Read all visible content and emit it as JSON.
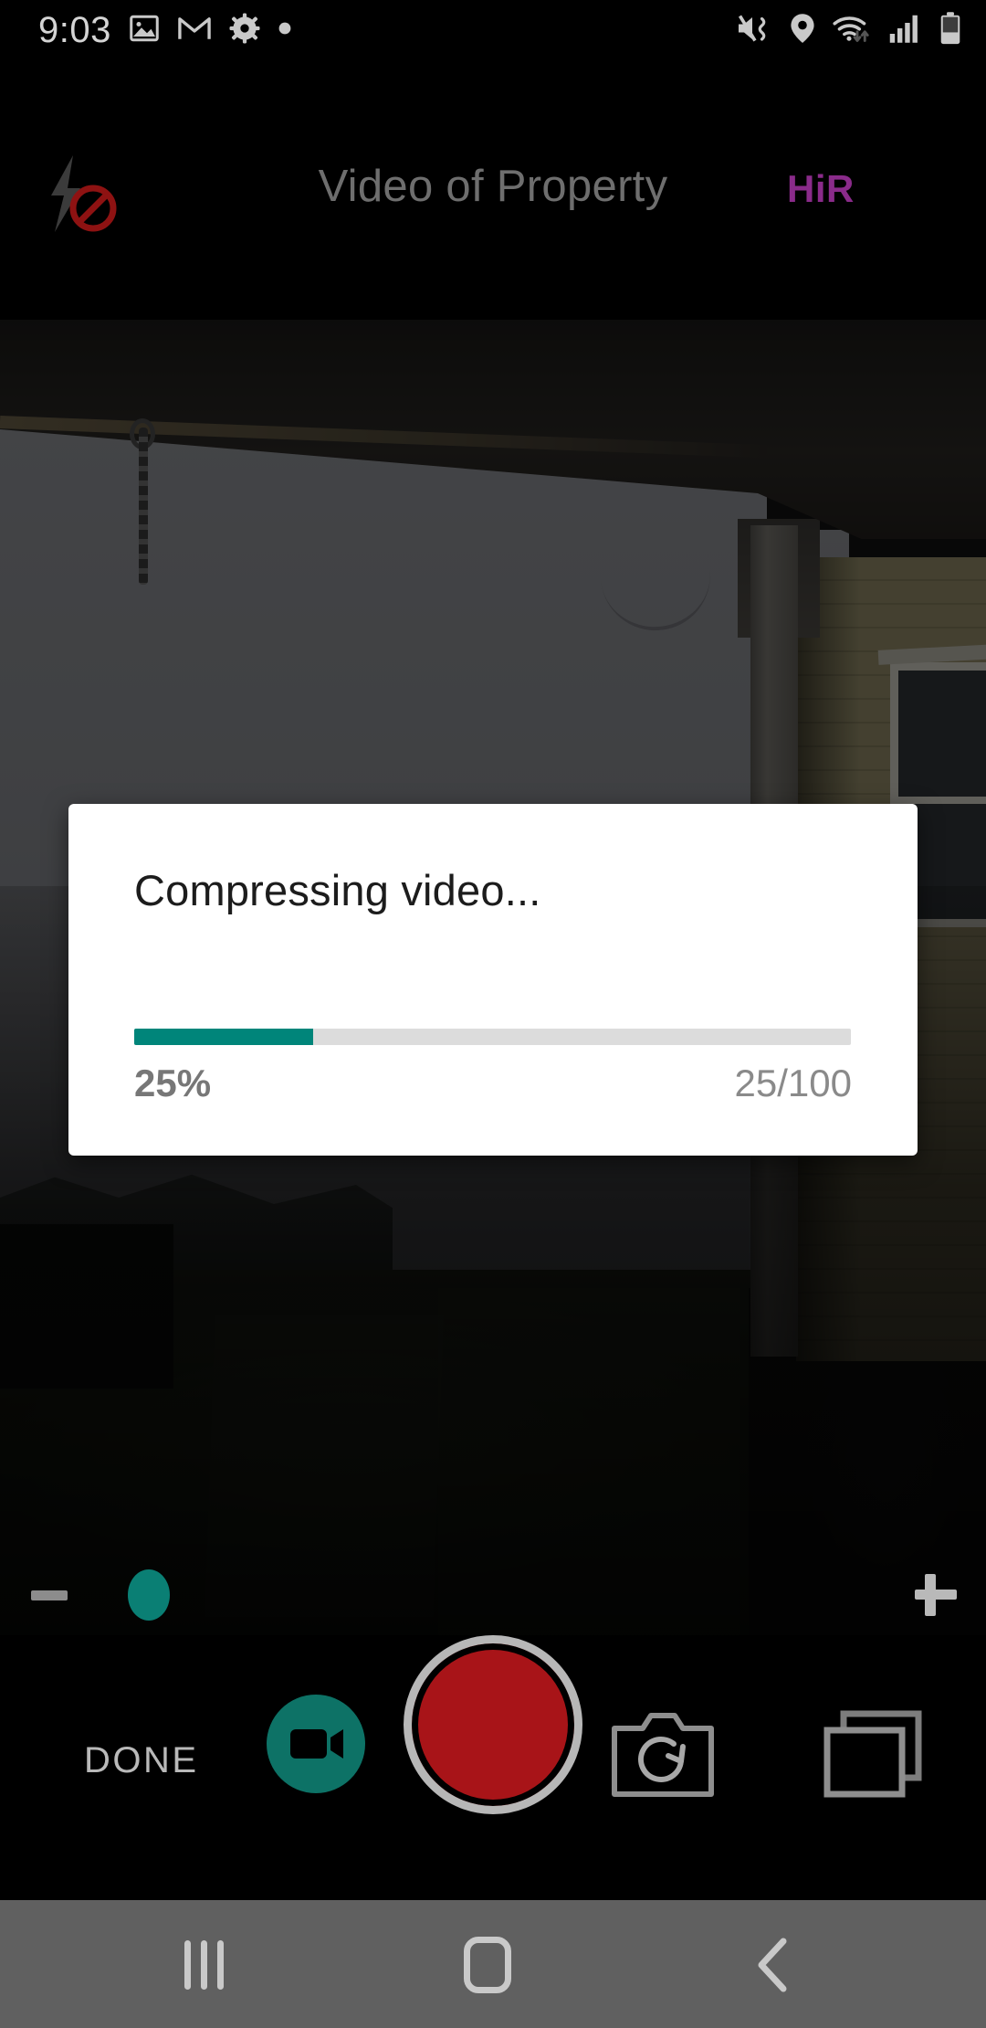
{
  "status_bar": {
    "time": "9:03",
    "left_icons": [
      "gallery-icon",
      "gmail-icon",
      "settings-gear-icon",
      "dot-icon"
    ],
    "right_icons": [
      "mute-vibrate-icon",
      "location-pin-icon",
      "wifi-icon",
      "signal-bars-icon",
      "battery-icon"
    ],
    "battery_level": "40"
  },
  "app_bar": {
    "flash_icon": "flash-off-icon",
    "title": "Video of Property",
    "hires_label": "HiR",
    "hires_color": "#8a2b8a"
  },
  "camera_preview": {
    "scene_description": "Outdoor covered porch view: dark soffit overhang at top, overcast gray sky, hanging chain at left, support post at right of center, yellow siding house wall with window at right, dark lawn below",
    "dimmed_by_dialog": "true"
  },
  "zoom_slider": {
    "zoom_out_icon": "minus-icon",
    "zoom_in_icon": "plus-icon",
    "thumb_position_percent": "8",
    "thumb_color": "#0a7f74"
  },
  "camera_controls": {
    "done_label": "DONE",
    "video_mode_icon": "video-camera-icon",
    "video_mode_color": "#0d7266",
    "record_icon": "record-button-icon",
    "record_color": "#a81418",
    "flip_camera_icon": "camera-flip-icon",
    "gallery_icon": "gallery-stack-icon"
  },
  "dialog": {
    "title": "Compressing video...",
    "percent_label": "25%",
    "count_label": "25/100",
    "progress_value": 25,
    "progress_max": 100,
    "progress_color": "#00857a",
    "track_color": "#dcdcdc"
  },
  "nav_bar": {
    "recents_icon": "recents-icon",
    "home_icon": "home-icon",
    "back_icon": "back-chevron-icon",
    "background_color": "#606060"
  }
}
